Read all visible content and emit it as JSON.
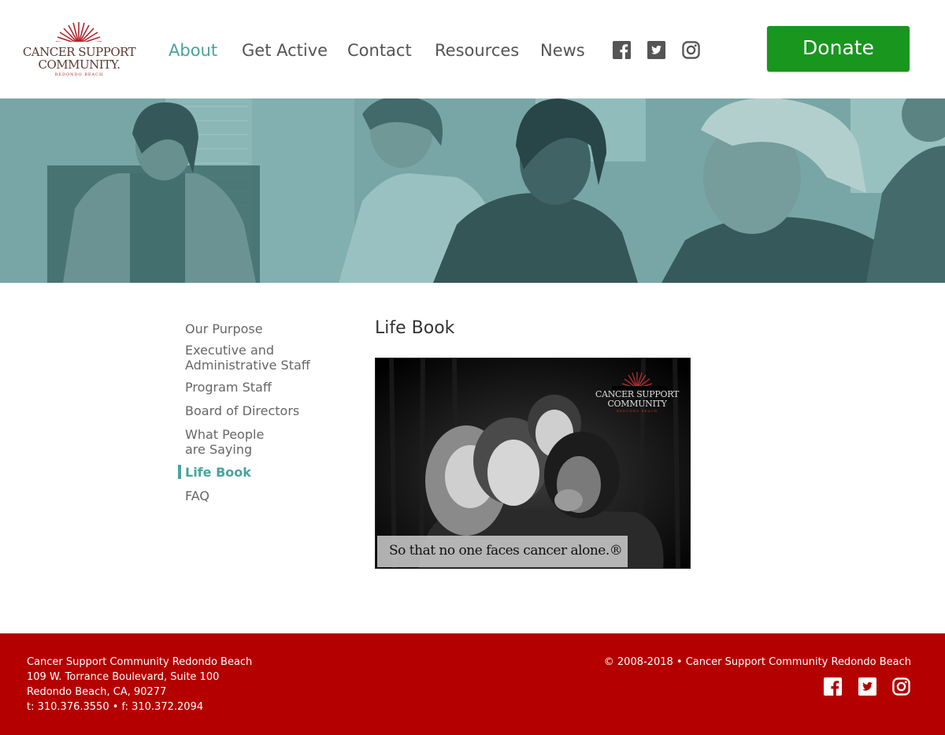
{
  "header": {
    "logo": {
      "line1": "CANCER SUPPORT",
      "line2": "COMMUNITY.",
      "line3": "REDONDO BEACH"
    },
    "nav": [
      {
        "label": "About",
        "active": true
      },
      {
        "label": "Get Active",
        "active": false
      },
      {
        "label": "Contact",
        "active": false
      },
      {
        "label": "Resources",
        "active": false
      },
      {
        "label": "News",
        "active": false
      }
    ],
    "social": [
      "facebook-icon",
      "twitter-icon",
      "instagram-icon"
    ],
    "donate_label": "Donate"
  },
  "sidebar": {
    "items": [
      {
        "label": "Our Purpose"
      },
      {
        "label": "Executive and Administrative Staff"
      },
      {
        "label": "Program Staff"
      },
      {
        "label": "Board of Directors"
      },
      {
        "label": "What People are Saying"
      },
      {
        "label": "Life Book",
        "active": true
      },
      {
        "label": "FAQ"
      }
    ]
  },
  "main": {
    "title": "Life Book",
    "image": {
      "logo_line1": "CANCER SUPPORT",
      "logo_line2": "COMMUNITY",
      "logo_line3": "REDONDO BEACH",
      "caption": "So that no one  faces cancer alone.®"
    }
  },
  "footer": {
    "org": "Cancer Support Community Redondo Beach",
    "address1": "109 W. Torrance Boulevard, Suite 100",
    "address2": "Redondo Beach, CA, 90277",
    "phone": "t: 310.376.3550 • f: 310.372.2094",
    "copyright": "© 2008-2018 • Cancer Support Community Redondo Beach",
    "social": [
      "facebook-icon",
      "twitter-icon",
      "instagram-icon"
    ]
  },
  "colors": {
    "accent": "#4aa3a0",
    "donate": "#18961e",
    "footer": "#b50000",
    "brand_red": "#b2242b"
  }
}
